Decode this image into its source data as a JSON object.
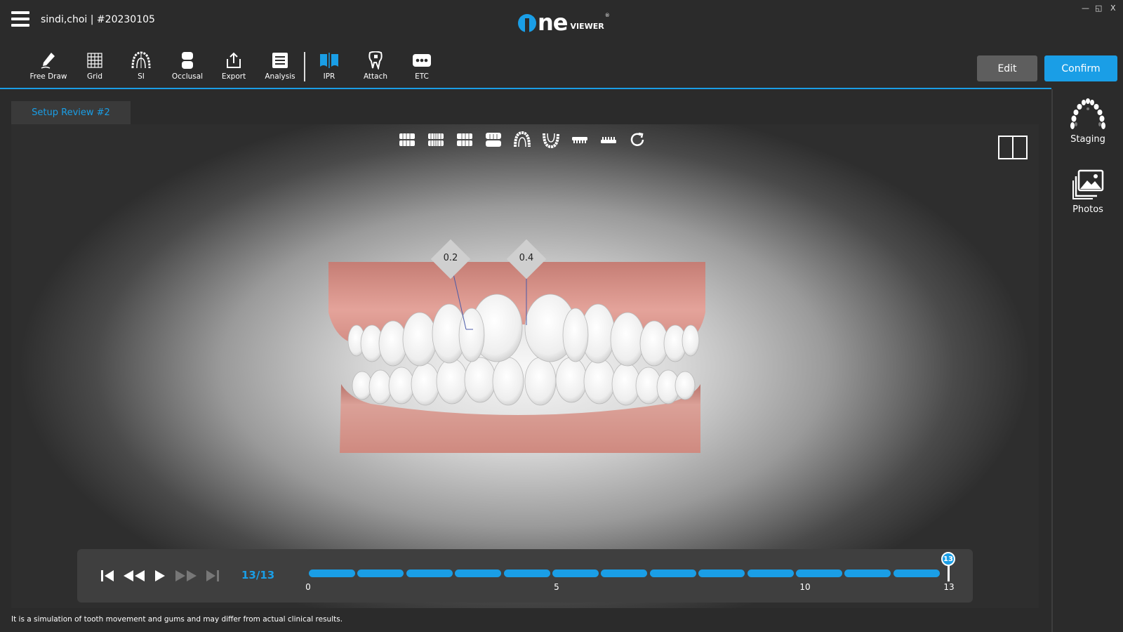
{
  "window": {
    "patient_label": "sindi,choi | #20230105",
    "logo_main": "ne",
    "logo_sub": "VIEWER",
    "logo_reg": "®",
    "controls": {
      "minimize": "—",
      "restore": "◱",
      "close": "X"
    }
  },
  "toolbar": {
    "items": [
      {
        "label": "Free Draw",
        "icon": "pencil-icon"
      },
      {
        "label": "Grid",
        "icon": "grid-icon"
      },
      {
        "label": "SI",
        "icon": "arch-icon"
      },
      {
        "label": "Occlusal",
        "icon": "tooth-occlusal-icon"
      },
      {
        "label": "Export",
        "icon": "export-icon"
      },
      {
        "label": "Analysis",
        "icon": "analysis-icon"
      },
      {
        "label": "IPR",
        "icon": "ipr-icon"
      },
      {
        "label": "Attach",
        "icon": "attach-icon"
      },
      {
        "label": "ETC",
        "icon": "more-icon"
      }
    ],
    "edit_label": "Edit",
    "confirm_label": "Confirm"
  },
  "sidebar": {
    "items": [
      {
        "label": "Staging",
        "icon": "staging-arch-icon"
      },
      {
        "label": "Photos",
        "icon": "photos-icon"
      }
    ]
  },
  "tab": {
    "label": "Setup Review #2"
  },
  "viewport": {
    "ipr_values": [
      "0.2",
      "0.4"
    ]
  },
  "player": {
    "frame_count": "13/13",
    "current_step": "13",
    "total_steps": 13,
    "ticks": [
      "0",
      "5",
      "10",
      "13"
    ]
  },
  "colors": {
    "accent": "#1a9ee6",
    "gum": "#d9928a",
    "background": "#2b2b2b"
  },
  "footer": {
    "disclaimer": "It is a simulation of tooth movement and gums and may differ from actual clinical results."
  }
}
